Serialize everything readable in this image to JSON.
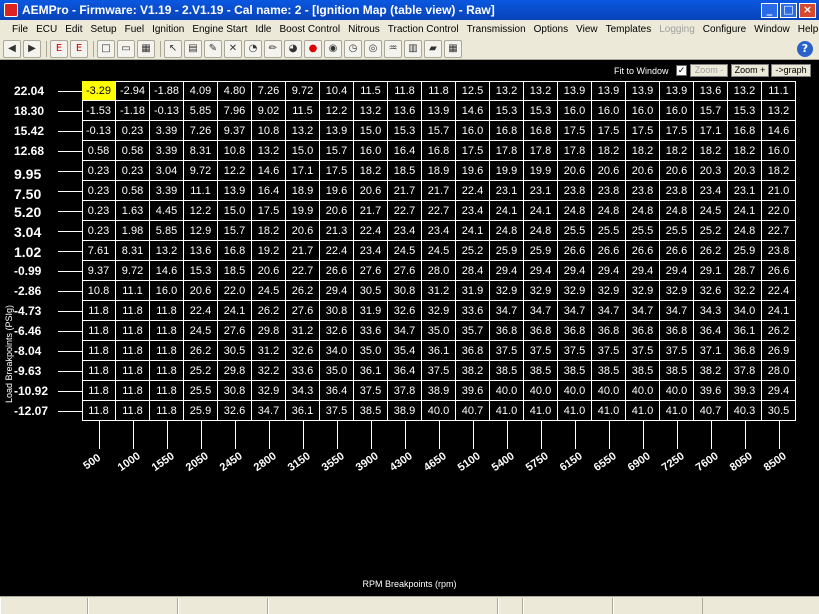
{
  "window": {
    "title": "AEMPro - Firmware: V1.19 - 2.V1.19 - Cal name: 2       - [Ignition Map (table view) - Raw]",
    "minimize": "_",
    "maximize": "□",
    "close": "×"
  },
  "menu": {
    "items": [
      {
        "label": "File"
      },
      {
        "label": "ECU"
      },
      {
        "label": "Edit"
      },
      {
        "label": "Setup"
      },
      {
        "label": "Fuel"
      },
      {
        "label": "Ignition"
      },
      {
        "label": "Engine Start"
      },
      {
        "label": "Idle"
      },
      {
        "label": "Boost Control"
      },
      {
        "label": "Nitrous"
      },
      {
        "label": "Traction Control"
      },
      {
        "label": "Transmission"
      },
      {
        "label": "Options"
      },
      {
        "label": "View"
      },
      {
        "label": "Templates"
      },
      {
        "label": "Logging",
        "disabled": true
      },
      {
        "label": "Configure"
      },
      {
        "label": "Window"
      },
      {
        "label": "Help"
      }
    ],
    "doc_min": "_",
    "doc_max": "□",
    "doc_close": "×"
  },
  "toolbar": {
    "icons": [
      "back-icon",
      "forward-icon",
      "ecu-read-icon",
      "ecu-write-icon",
      "new-icon",
      "open-icon",
      "save-icon",
      "cursor-icon",
      "chart-icon",
      "wizard-icon",
      "tools-icon",
      "gauge-icon",
      "pencil-icon",
      "speedometer-icon",
      "stop-icon",
      "power-icon",
      "timer-icon",
      "target-icon",
      "tune-icon",
      "grid-icon",
      "car-icon",
      "table-icon"
    ],
    "help": "?"
  },
  "controls": {
    "fit_label": "Fit to Window",
    "fit_checked": "✓",
    "zoom_minus": "Zoom -",
    "zoom_plus": "Zoom +",
    "graph": "->graph"
  },
  "chart_data": {
    "type": "table",
    "xlabel": "RPM Breakpoints (rpm)",
    "ylabel": "Load Breakpoints (PSIg)",
    "x": [
      500,
      1000,
      1550,
      2050,
      2450,
      2800,
      3150,
      3550,
      3900,
      4300,
      4650,
      5100,
      5400,
      5750,
      6150,
      6550,
      6900,
      7250,
      7600,
      8050,
      8500
    ],
    "y": [
      22.04,
      18.3,
      15.42,
      12.68,
      9.95,
      7.5,
      5.2,
      3.04,
      1.02,
      -0.99,
      -2.86,
      -4.73,
      -6.46,
      -8.04,
      -9.63,
      -10.92,
      -12.07
    ],
    "y_display": [
      "22.04",
      "18.30",
      "15.42",
      "12.68",
      "9.95",
      "7.50",
      "5.20",
      "3.04",
      "1.02",
      "-0.99",
      "-2.86",
      "-4.73",
      "-6.46",
      "-8.04",
      "-9.63",
      "-10.92",
      "-12.07"
    ],
    "selected": [
      0,
      0
    ],
    "values": [
      [
        "-3.29",
        "-2.94",
        "-1.88",
        "4.09",
        "4.80",
        "7.26",
        "9.72",
        "10.4",
        "11.5",
        "11.8",
        "11.8",
        "12.5",
        "13.2",
        "13.2",
        "13.9",
        "13.9",
        "13.9",
        "13.9",
        "13.6",
        "13.2",
        "11.1"
      ],
      [
        "-1.53",
        "-1.18",
        "-0.13",
        "5.85",
        "7.96",
        "9.02",
        "11.5",
        "12.2",
        "13.2",
        "13.6",
        "13.9",
        "14.6",
        "15.3",
        "15.3",
        "16.0",
        "16.0",
        "16.0",
        "16.0",
        "15.7",
        "15.3",
        "13.2"
      ],
      [
        "-0.13",
        "0.23",
        "3.39",
        "7.26",
        "9.37",
        "10.8",
        "13.2",
        "13.9",
        "15.0",
        "15.3",
        "15.7",
        "16.0",
        "16.8",
        "16.8",
        "17.5",
        "17.5",
        "17.5",
        "17.5",
        "17.1",
        "16.8",
        "14.6"
      ],
      [
        "0.58",
        "0.58",
        "3.39",
        "8.31",
        "10.8",
        "13.2",
        "15.0",
        "15.7",
        "16.0",
        "16.4",
        "16.8",
        "17.5",
        "17.8",
        "17.8",
        "17.8",
        "18.2",
        "18.2",
        "18.2",
        "18.2",
        "18.2",
        "16.0"
      ],
      [
        "0.23",
        "0.23",
        "3.04",
        "9.72",
        "12.2",
        "14.6",
        "17.1",
        "17.5",
        "18.2",
        "18.5",
        "18.9",
        "19.6",
        "19.9",
        "19.9",
        "20.6",
        "20.6",
        "20.6",
        "20.6",
        "20.3",
        "20.3",
        "18.2"
      ],
      [
        "0.23",
        "0.58",
        "3.39",
        "11.1",
        "13.9",
        "16.4",
        "18.9",
        "19.6",
        "20.6",
        "21.7",
        "21.7",
        "22.4",
        "23.1",
        "23.1",
        "23.8",
        "23.8",
        "23.8",
        "23.8",
        "23.4",
        "23.1",
        "21.0"
      ],
      [
        "0.23",
        "1.63",
        "4.45",
        "12.2",
        "15.0",
        "17.5",
        "19.9",
        "20.6",
        "21.7",
        "22.7",
        "22.7",
        "23.4",
        "24.1",
        "24.1",
        "24.8",
        "24.8",
        "24.8",
        "24.8",
        "24.5",
        "24.1",
        "22.0"
      ],
      [
        "0.23",
        "1.98",
        "5.85",
        "12.9",
        "15.7",
        "18.2",
        "20.6",
        "21.3",
        "22.4",
        "23.4",
        "23.4",
        "24.1",
        "24.8",
        "24.8",
        "25.5",
        "25.5",
        "25.5",
        "25.5",
        "25.2",
        "24.8",
        "22.7"
      ],
      [
        "7.61",
        "8.31",
        "13.2",
        "13.6",
        "16.8",
        "19.2",
        "21.7",
        "22.4",
        "23.4",
        "24.5",
        "24.5",
        "25.2",
        "25.9",
        "25.9",
        "26.6",
        "26.6",
        "26.6",
        "26.6",
        "26.2",
        "25.9",
        "23.8"
      ],
      [
        "9.37",
        "9.72",
        "14.6",
        "15.3",
        "18.5",
        "20.6",
        "22.7",
        "26.6",
        "27.6",
        "27.6",
        "28.0",
        "28.4",
        "29.4",
        "29.4",
        "29.4",
        "29.4",
        "29.4",
        "29.4",
        "29.1",
        "28.7",
        "26.6"
      ],
      [
        "10.8",
        "11.1",
        "16.0",
        "20.6",
        "22.0",
        "24.5",
        "26.2",
        "29.4",
        "30.5",
        "30.8",
        "31.2",
        "31.9",
        "32.9",
        "32.9",
        "32.9",
        "32.9",
        "32.9",
        "32.9",
        "32.6",
        "32.2",
        "22.4"
      ],
      [
        "11.8",
        "11.8",
        "11.8",
        "22.4",
        "24.1",
        "26.2",
        "27.6",
        "30.8",
        "31.9",
        "32.6",
        "32.9",
        "33.6",
        "34.7",
        "34.7",
        "34.7",
        "34.7",
        "34.7",
        "34.7",
        "34.3",
        "34.0",
        "24.1"
      ],
      [
        "11.8",
        "11.8",
        "11.8",
        "24.5",
        "27.6",
        "29.8",
        "31.2",
        "32.6",
        "33.6",
        "34.7",
        "35.0",
        "35.7",
        "36.8",
        "36.8",
        "36.8",
        "36.8",
        "36.8",
        "36.8",
        "36.4",
        "36.1",
        "26.2"
      ],
      [
        "11.8",
        "11.8",
        "11.8",
        "26.2",
        "30.5",
        "31.2",
        "32.6",
        "34.0",
        "35.0",
        "35.4",
        "36.1",
        "36.8",
        "37.5",
        "37.5",
        "37.5",
        "37.5",
        "37.5",
        "37.5",
        "37.1",
        "36.8",
        "26.9"
      ],
      [
        "11.8",
        "11.8",
        "11.8",
        "25.2",
        "29.8",
        "32.2",
        "33.6",
        "35.0",
        "36.1",
        "36.4",
        "37.5",
        "38.2",
        "38.5",
        "38.5",
        "38.5",
        "38.5",
        "38.5",
        "38.5",
        "38.2",
        "37.8",
        "28.0"
      ],
      [
        "11.8",
        "11.8",
        "11.8",
        "25.5",
        "30.8",
        "32.9",
        "34.3",
        "36.4",
        "37.5",
        "37.8",
        "38.9",
        "39.6",
        "40.0",
        "40.0",
        "40.0",
        "40.0",
        "40.0",
        "40.0",
        "39.6",
        "39.3",
        "29.4"
      ],
      [
        "11.8",
        "11.8",
        "11.8",
        "25.9",
        "32.6",
        "34.7",
        "36.1",
        "37.5",
        "38.5",
        "38.9",
        "40.0",
        "40.7",
        "41.0",
        "41.0",
        "41.0",
        "41.0",
        "41.0",
        "41.0",
        "40.7",
        "40.3",
        "30.5"
      ]
    ]
  }
}
